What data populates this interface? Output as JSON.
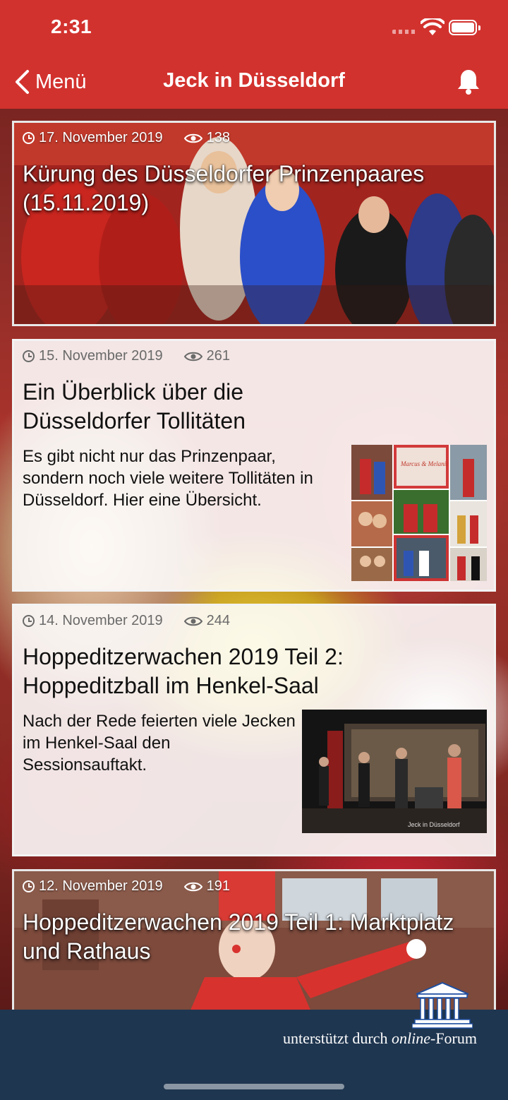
{
  "status_bar": {
    "time": "2:31"
  },
  "nav": {
    "back_label": "Menü",
    "title": "Jeck in Düsseldorf"
  },
  "articles": [
    {
      "date": "17. November 2019",
      "views": "138",
      "title": "Kürung des Düsseldorfer Prinzenpaares (15.11.2019)",
      "style": "photo"
    },
    {
      "date": "15. November 2019",
      "views": "261",
      "title": "Ein Überblick über die Düsseldorfer Tollitäten",
      "excerpt": "Es gibt nicht nur das Prinzenpaar, sondern noch viele weitere Tollitäten in Düsseldorf. Hier eine Übersicht.",
      "thumb_text": "Marcus & Melanie",
      "style": "light"
    },
    {
      "date": "14. November 2019",
      "views": "244",
      "title": "Hoppeditzerwachen 2019 Teil 2: Hoppeditzball im Henkel-Saal",
      "excerpt": "Nach der Rede feierten viele Jecken im Henkel-Saal den Sessionsauftakt.",
      "thumb_caption": "Jeck in Düsseldorf",
      "style": "light"
    },
    {
      "date": "12. November 2019",
      "views": "191",
      "title": "Hoppeditzerwachen 2019 Teil 1: Marktplatz und Rathaus",
      "style": "photo"
    }
  ],
  "footer": {
    "support_prefix": "unterstützt durch",
    "support_brand": "online",
    "support_suffix": "-Forum"
  },
  "colors": {
    "brand_red": "#d2322e",
    "footer_navy": "#1f3650"
  }
}
